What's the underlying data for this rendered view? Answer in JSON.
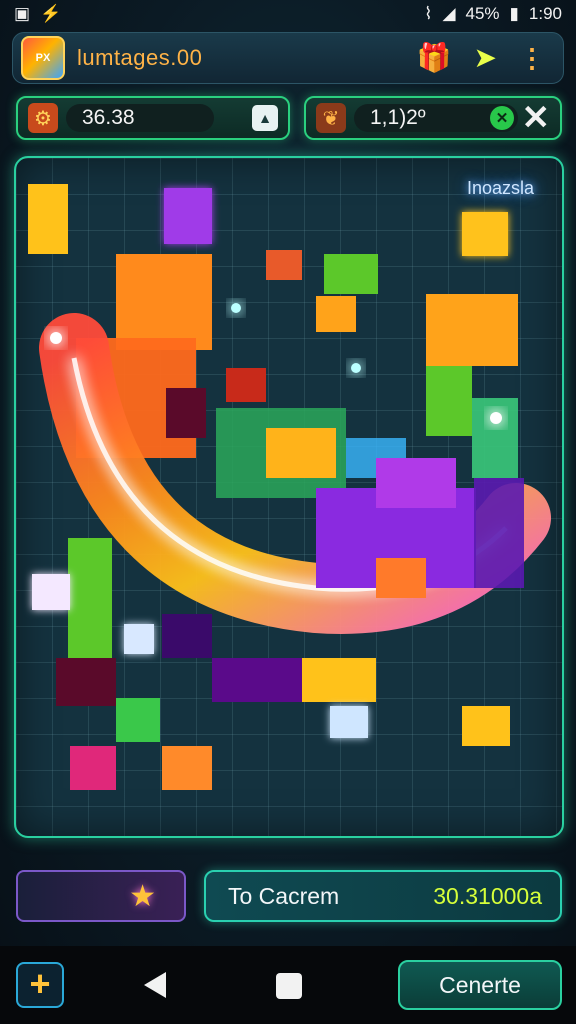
{
  "status_bar": {
    "battery": "45%",
    "time": "1:90",
    "icons": [
      "gallery-icon",
      "usb-icon",
      "no-wifi-icon",
      "signal-icon",
      "battery-icon"
    ]
  },
  "header": {
    "title": "lumtages.00",
    "app_icon_text": "PX",
    "actions": [
      "gift-icon",
      "send-icon",
      "menu-dots-icon"
    ]
  },
  "stats": {
    "left_value": "36.38",
    "left_icon": "gear-icon",
    "right_value": "1,1)2º",
    "right_icon": "dragon-icon",
    "right_badge": "✕",
    "photo_icon": "photo-icon",
    "close_icon": "close-icon"
  },
  "board": {
    "label": "Inoazsla",
    "colors": {
      "orange": "#ff8a1c",
      "yellow": "#ffc21a",
      "green": "#5cc82a",
      "purple": "#8a2ae0",
      "magenta": "#e0287a",
      "pink": "#ff4aa8",
      "white_glow": "#ffffff"
    }
  },
  "footer": {
    "hint_icon": "star-icon",
    "goal_label": "To Cacrem",
    "goal_value": "30.31000a"
  },
  "nav": {
    "add_label": "+",
    "confirm_label": "Cenerte",
    "icons": [
      "back-icon",
      "home-icon"
    ]
  }
}
